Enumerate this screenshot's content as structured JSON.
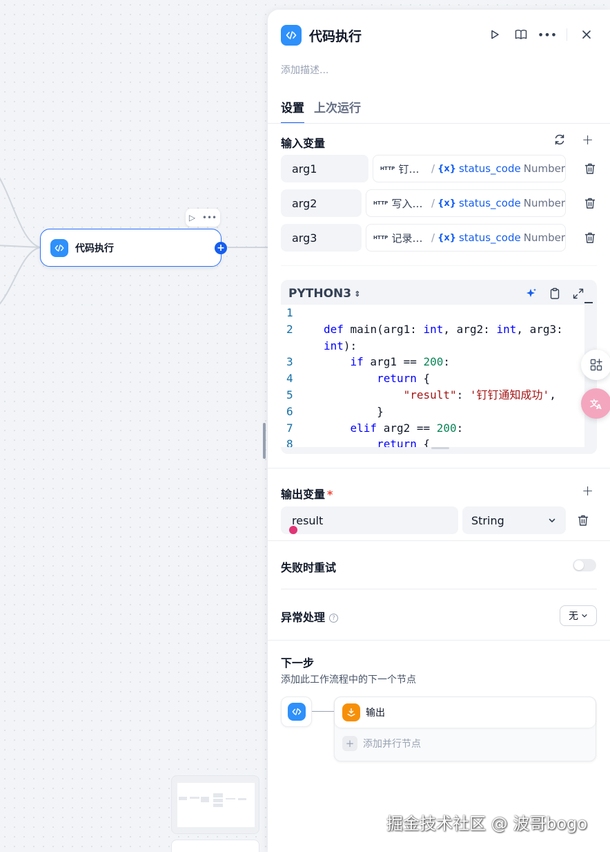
{
  "canvas": {
    "node_title": "代码执行"
  },
  "panel": {
    "title": "代码执行",
    "description_placeholder": "添加描述...",
    "tabs": [
      {
        "label": "设置",
        "active": true
      },
      {
        "label": "上次运行",
        "active": false
      }
    ],
    "input_section": {
      "title": "输入变量",
      "variables": [
        {
          "name": "arg1",
          "source_tag": "HTTP",
          "source": "钉钉通...",
          "var": "status_code",
          "type": "Number"
        },
        {
          "name": "arg2",
          "source_tag": "HTTP",
          "source": "写入数...",
          "var": "status_code",
          "type": "Number"
        },
        {
          "name": "arg3",
          "source_tag": "HTTP",
          "source": "记录到...",
          "var": "status_code",
          "type": "Number"
        }
      ]
    },
    "code": {
      "language": "PYTHON3",
      "lines": [
        {
          "n": "1",
          "text": ""
        },
        {
          "n": "2",
          "text": "def main(arg1: int, arg2: int, arg3:"
        },
        {
          "n": "",
          "text": "int):"
        },
        {
          "n": "3",
          "text": "    if arg1 == 200:"
        },
        {
          "n": "4",
          "text": "        return {"
        },
        {
          "n": "5",
          "text": "            \"result\": '钉钉通知成功',"
        },
        {
          "n": "6",
          "text": "        }"
        },
        {
          "n": "7",
          "text": "    elif arg2 == 200:"
        },
        {
          "n": "8",
          "text": "        return {"
        }
      ]
    },
    "output_section": {
      "title": "输出变量",
      "required_mark": "*",
      "variable_name": "result",
      "variable_type": "String"
    },
    "retry": {
      "label": "失败时重试",
      "enabled": false
    },
    "error_handling": {
      "label": "异常处理",
      "help": "?",
      "value": "无"
    },
    "next_step": {
      "title": "下一步",
      "description": "添加此工作流程中的下一个节点",
      "next_node": "输出",
      "add_parallel": "添加并行节点"
    }
  },
  "watermark": "掘金技术社区 @ 波哥bogo",
  "colors": {
    "accent": "#155eef",
    "code_badge": "#2e90fa",
    "output_badge": "#f79009",
    "required": "#f04438"
  }
}
